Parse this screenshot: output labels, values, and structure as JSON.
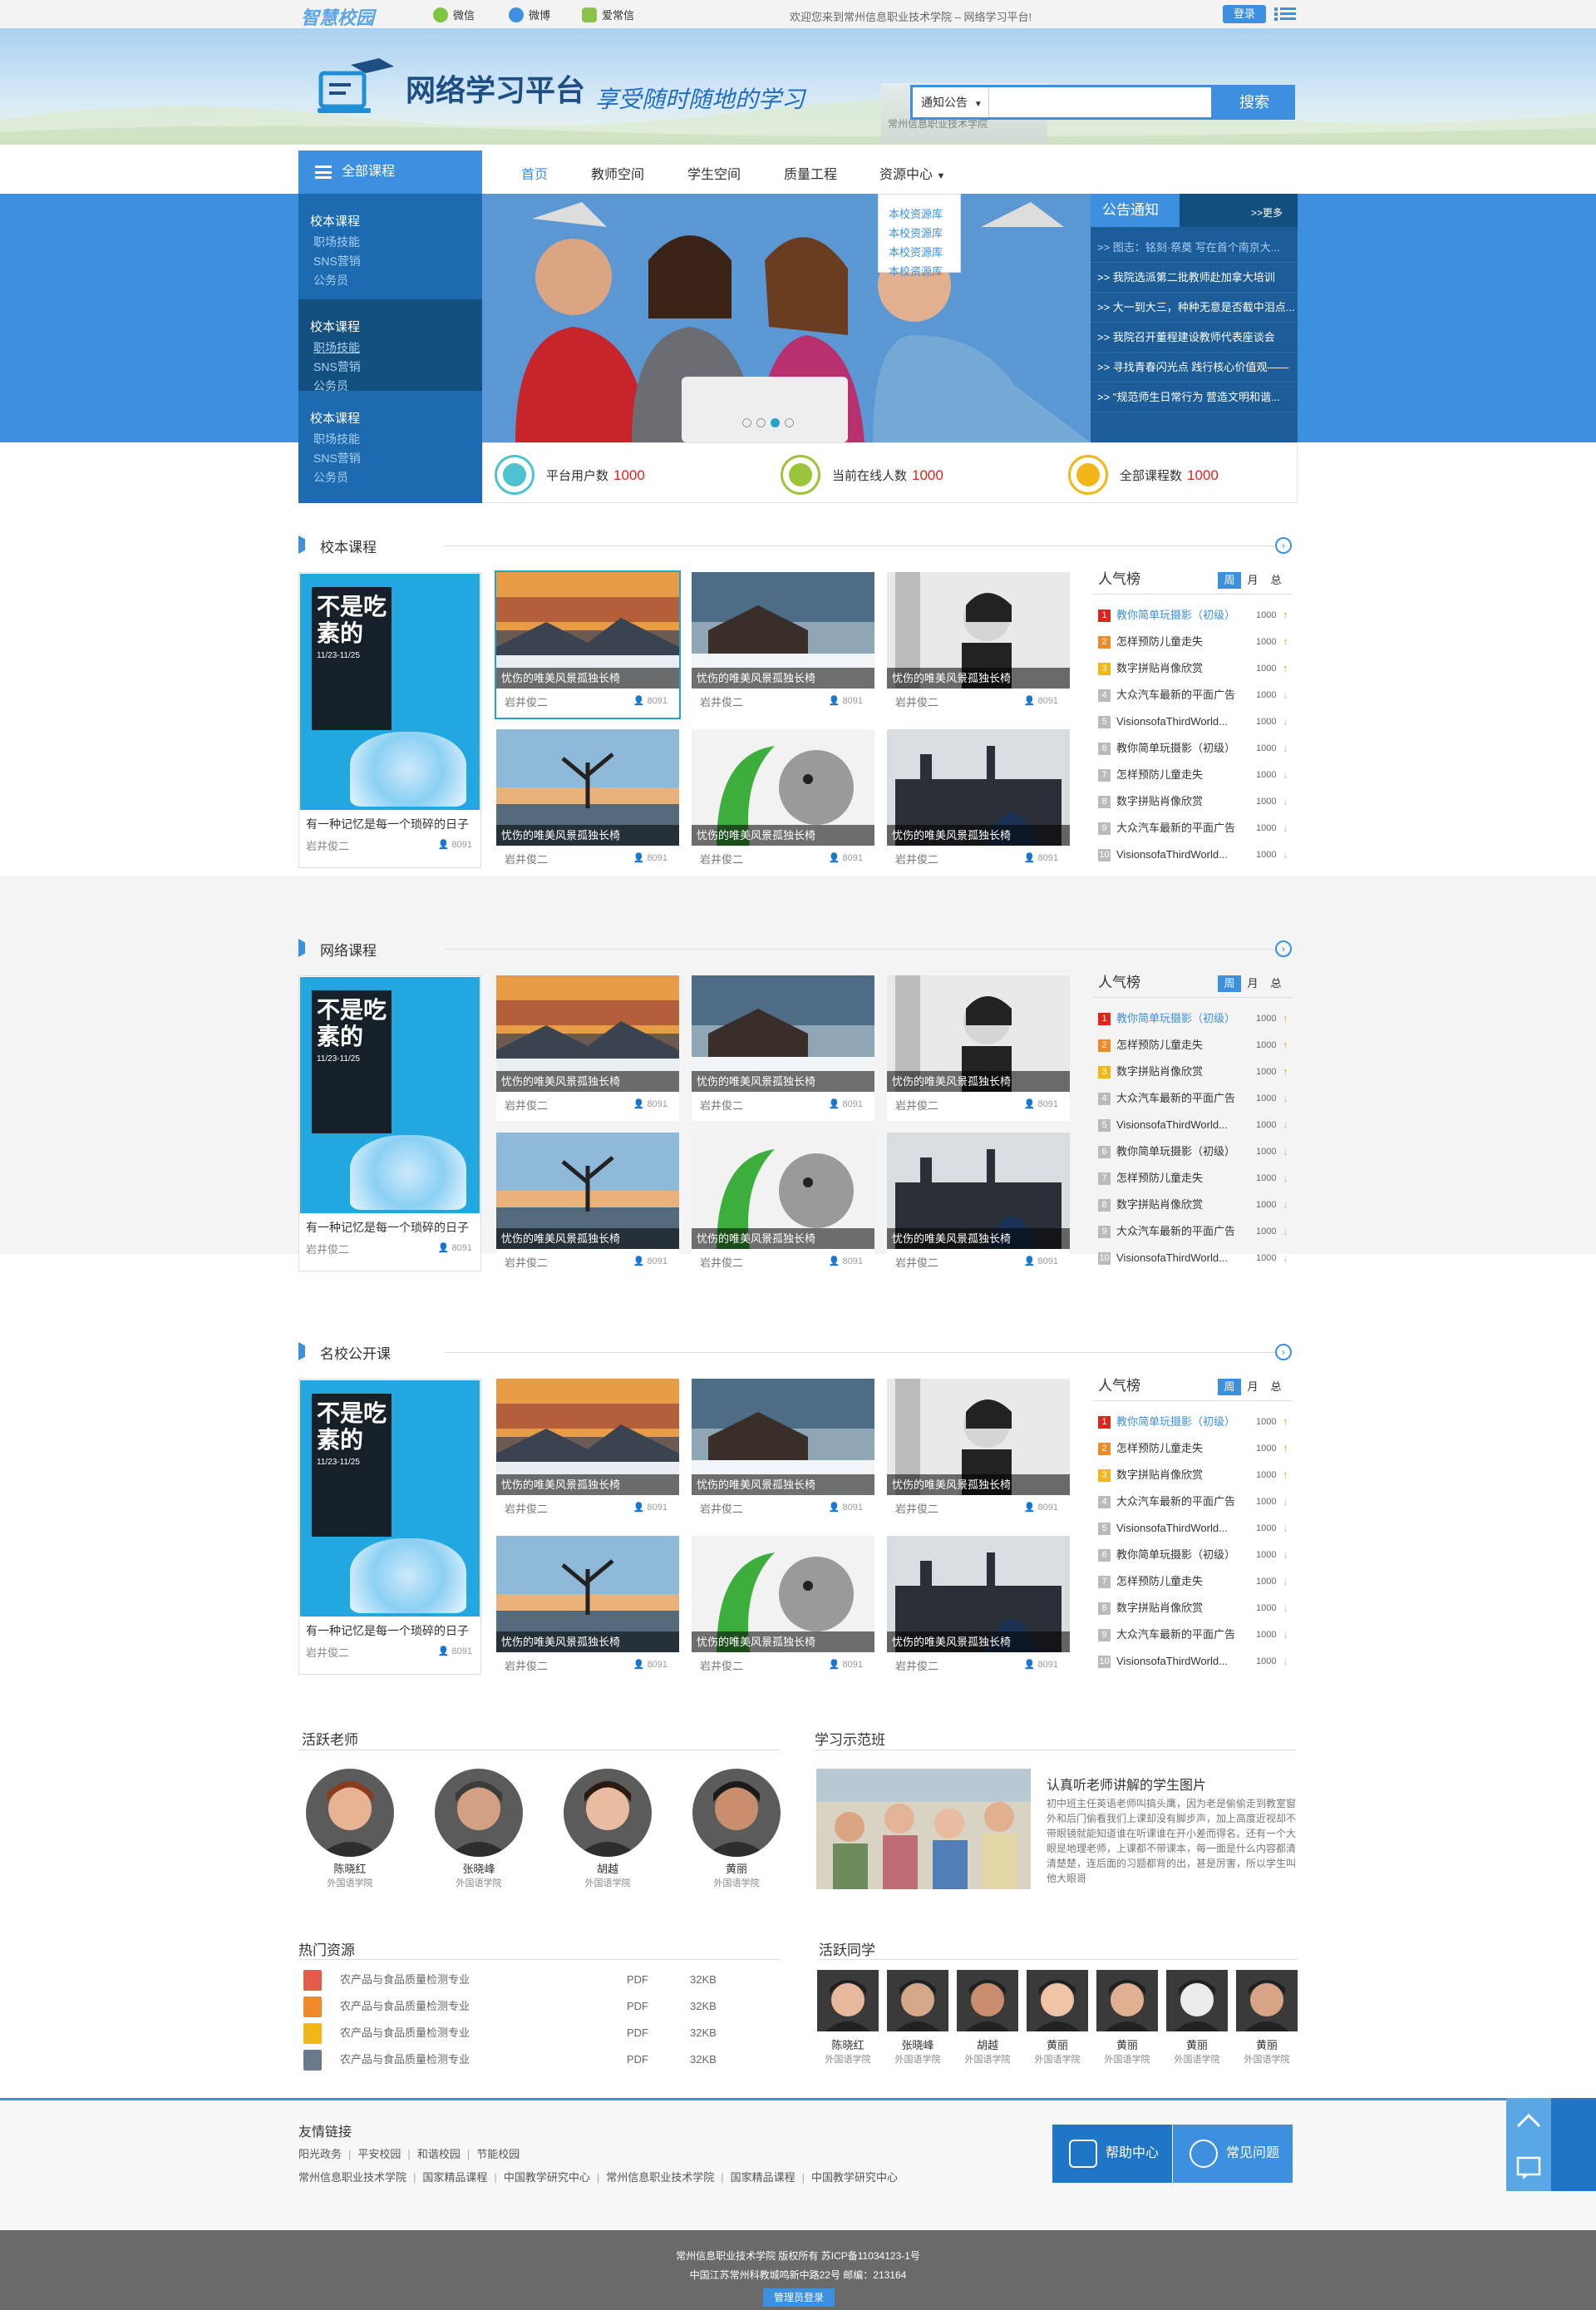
{
  "topbar": {
    "logo": "智慧校园",
    "weixin": "微信",
    "weibo": "微博",
    "aichangxin": "爱常信",
    "welcome": "欢迎您来到常州信息职业技术学院 – 网络学习平台!",
    "login": "登录"
  },
  "header": {
    "title": "网络学习平台",
    "slogan": "享受随时随地的学习",
    "school_sign": "常州信息职业技术学院",
    "search_select": "通知公告",
    "search_placeholder": "",
    "search_button": "搜索"
  },
  "nav": {
    "all_courses": "全部课程",
    "items": [
      "首页",
      "教师空间",
      "学生空间",
      "质量工程",
      "资源中心"
    ]
  },
  "resource_dropdown": [
    "本校资源库",
    "本校资源库",
    "本校资源库",
    "本校资源库"
  ],
  "sidebar": [
    {
      "title": "校本课程",
      "items": [
        "职场技能",
        "SNS营销",
        "公务员"
      ]
    },
    {
      "title": "校本课程",
      "items": [
        "职场技能",
        "SNS营销",
        "公务员"
      ]
    },
    {
      "title": "校本课程",
      "items": [
        "职场技能",
        "SNS营销",
        "公务员"
      ]
    }
  ],
  "notice": {
    "title": "公告通知",
    "more": ">>更多",
    "items": [
      ">> 图志：铭刻·祭奠 写在首个南京大...",
      ">> 我院选派第二批教师赴加拿大培训",
      ">> 大一到大三，种种无意是否截中泪点...",
      ">> 我院召开董程建设教师代表座谈会",
      ">> 寻找青春闪光点 践行核心价值观——",
      ">> \"规范师生日常行为 营造文明和谐..."
    ]
  },
  "stats": [
    {
      "label": "平台用户数",
      "value": "1000",
      "color": "#4ec2d0"
    },
    {
      "label": "当前在线人数",
      "value": "1000",
      "color": "#9bc43b"
    },
    {
      "label": "全部课程数",
      "value": "1000",
      "color": "#f2b619"
    }
  ],
  "sections": [
    {
      "title": "校本课程"
    },
    {
      "title": "网络课程"
    },
    {
      "title": "名校公开课"
    }
  ],
  "feature": {
    "poster_title": "不是吃素的",
    "poster_date": "11/23-11/25",
    "title": "有一种记忆是每一个琐碎的日子",
    "author": "岩井俊二",
    "count": "8091"
  },
  "card": {
    "caption": "忧伤的唯美风景孤独长椅",
    "author": "岩井俊二",
    "count": "8091"
  },
  "rank": {
    "title": "人气榜",
    "tabs": [
      "周",
      "月",
      "总"
    ],
    "items": [
      {
        "n": "1",
        "t": "教你简单玩摄影（初级）",
        "v": "1000",
        "trend": "up"
      },
      {
        "n": "2",
        "t": "怎样预防儿童走失",
        "v": "1000",
        "trend": "up"
      },
      {
        "n": "3",
        "t": "数字拼贴肖像欣赏",
        "v": "1000",
        "trend": "up"
      },
      {
        "n": "4",
        "t": "大众汽车最新的平面广告",
        "v": "1000",
        "trend": "down"
      },
      {
        "n": "5",
        "t": "VisionsofaThirdWorld...",
        "v": "1000",
        "trend": "down"
      },
      {
        "n": "6",
        "t": "教你简单玩摄影（初级）",
        "v": "1000",
        "trend": "down"
      },
      {
        "n": "7",
        "t": "怎样预防儿童走失",
        "v": "1000",
        "trend": "down"
      },
      {
        "n": "8",
        "t": "数字拼贴肖像欣赏",
        "v": "1000",
        "trend": "down"
      },
      {
        "n": "9",
        "t": "大众汽车最新的平面广告",
        "v": "1000",
        "trend": "down"
      },
      {
        "n": "10",
        "t": "VisionsofaThirdWorld...",
        "v": "1000",
        "trend": "down"
      }
    ]
  },
  "teachers": {
    "title": "活跃老师",
    "items": [
      {
        "name": "陈晓红",
        "dept": "外国语学院"
      },
      {
        "name": "张晓峰",
        "dept": "外国语学院"
      },
      {
        "name": "胡越",
        "dept": "外国语学院"
      },
      {
        "name": "黄丽",
        "dept": "外国语学院"
      }
    ]
  },
  "demo_class": {
    "title": "学习示范班",
    "headline": "认真听老师讲解的学生图片",
    "text": "初中班主任英语老师叫搞头鹰，因为老是偷偷走到教室窗外和后门偷看我们上课却没有脚步声，加上高度近视却不带眼镜就能知道谁在听课谁在开小差而得名。还有一个大眼是地理老师，上课都不带课本，每一面是什么内容都清清楚楚，连后面的习题都背的出，甚是厉害，所以学生叫他大眼哥"
  },
  "resources": {
    "title": "热门资源",
    "items": [
      {
        "icon": "pdf",
        "color": "#e25b4b",
        "name": "农产品与食品质量检测专业",
        "type": "PDF",
        "size": "32KB"
      },
      {
        "icon": "ppt",
        "color": "#f08a28",
        "name": "农产品与食品质量检测专业",
        "type": "PDF",
        "size": "32KB"
      },
      {
        "icon": "exe",
        "color": "#f2b619",
        "name": "农产品与食品质量检测专业",
        "type": "PDF",
        "size": "32KB"
      },
      {
        "icon": "txt",
        "color": "#6a7a8c",
        "name": "农产品与食品质量检测专业",
        "type": "PDF",
        "size": "32KB"
      }
    ]
  },
  "students": {
    "title": "活跃同学",
    "items": [
      {
        "name": "陈晓红",
        "dept": "外国语学院"
      },
      {
        "name": "张晓峰",
        "dept": "外国语学院"
      },
      {
        "name": "胡越",
        "dept": "外国语学院"
      },
      {
        "name": "黄丽",
        "dept": "外国语学院"
      },
      {
        "name": "黄丽",
        "dept": "外国语学院"
      },
      {
        "name": "黄丽",
        "dept": "外国语学院"
      },
      {
        "name": "黄丽",
        "dept": "外国语学院"
      }
    ]
  },
  "footer": {
    "links_title": "友情链接",
    "links_row1": [
      "阳光政务",
      "平安校园",
      "和谐校园",
      "节能校园"
    ],
    "links_row2": [
      "常州信息职业技术学院",
      "国家精品课程",
      "中国教学研究中心",
      "常州信息职业技术学院",
      "国家精品课程",
      "中国教学研究中心"
    ],
    "help_center": "帮助中心",
    "faq": "常见问题",
    "copyright": "常州信息职业技术学院 版权所有 苏ICP备11034123-1号",
    "address": "中国江苏常州科教城鸣新中路22号 邮编：213164",
    "admin_login": "管理员登录"
  }
}
